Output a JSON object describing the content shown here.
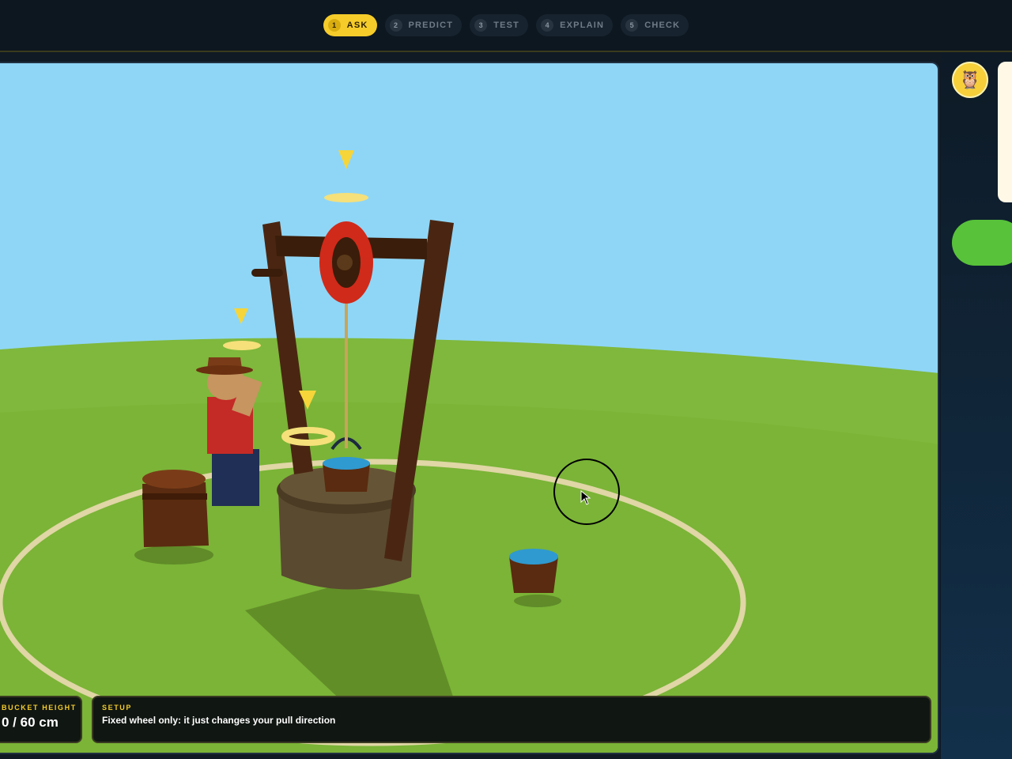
{
  "steps": [
    {
      "num": "1",
      "label": "ASK"
    },
    {
      "num": "2",
      "label": "PREDICT"
    },
    {
      "num": "3",
      "label": "TEST"
    },
    {
      "num": "4",
      "label": "EXPLAIN"
    },
    {
      "num": "5",
      "label": "CHECK"
    }
  ],
  "active_step": "ASK",
  "hud": {
    "height_label": "BUCKET HEIGHT",
    "height_value": "0 / 60 cm",
    "setup_label": "SETUP",
    "setup_text": "Fixed wheel only: it just changes your pull direction"
  },
  "assistant": {
    "icon": "owl-icon"
  },
  "colors": {
    "accent": "#f5cc2a",
    "sky": "#8fd6f6",
    "grass": "#7fb83c"
  }
}
